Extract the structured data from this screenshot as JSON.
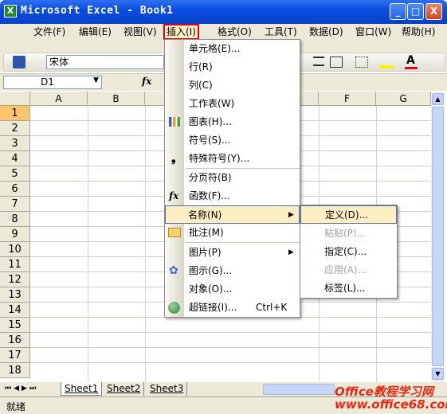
{
  "title": "Microsoft Excel - Book1",
  "window_buttons": [
    "_",
    "□",
    "X"
  ],
  "menubar": [
    {
      "label": "文件(F)"
    },
    {
      "label": "编辑(E)"
    },
    {
      "label": "视图(V)"
    },
    {
      "label": "插入(I)"
    },
    {
      "label": "格式(O)"
    },
    {
      "label": "工具(T)"
    },
    {
      "label": "数据(D)"
    },
    {
      "label": "窗口(W)"
    },
    {
      "label": "帮助(H)"
    }
  ],
  "font_name": "宋体",
  "name_box": "D1",
  "fx_label": "fx",
  "columns": [
    "A",
    "B",
    "F",
    "G"
  ],
  "rows": [
    "1",
    "2",
    "3",
    "4",
    "5",
    "6",
    "7",
    "8",
    "9",
    "10",
    "11",
    "12",
    "13",
    "14",
    "15",
    "16",
    "17",
    "18"
  ],
  "insert_menu": [
    {
      "label": "单元格(E)..."
    },
    {
      "label": "行(R)"
    },
    {
      "label": "列(C)"
    },
    {
      "label": "工作表(W)"
    },
    {
      "label": "图表(H)..."
    },
    {
      "label": "符号(S)..."
    },
    {
      "label": "特殊符号(Y)..."
    },
    {
      "label": "分页符(B)"
    },
    {
      "label": "函数(F)..."
    },
    {
      "label": "名称(N)"
    },
    {
      "label": "批注(M)"
    },
    {
      "label": "图片(P)"
    },
    {
      "label": "图示(G)..."
    },
    {
      "label": "对象(O)..."
    },
    {
      "label": "超链接(I)...",
      "shortcut": "Ctrl+K"
    }
  ],
  "name_submenu": [
    {
      "label": "定义(D)..."
    },
    {
      "label": "粘贴(P)..."
    },
    {
      "label": "指定(C)..."
    },
    {
      "label": "应用(A)..."
    },
    {
      "label": "标签(L)..."
    }
  ],
  "sheet_tabs": [
    "Sheet1",
    "Sheet2",
    "Sheet3"
  ],
  "status": "就绪",
  "watermark": "Office教程学习网\nwww.office68.com",
  "colors": {
    "title_bar": "#0a4ee0",
    "highlight": "#ffeec2",
    "callout": "#e0001a"
  }
}
